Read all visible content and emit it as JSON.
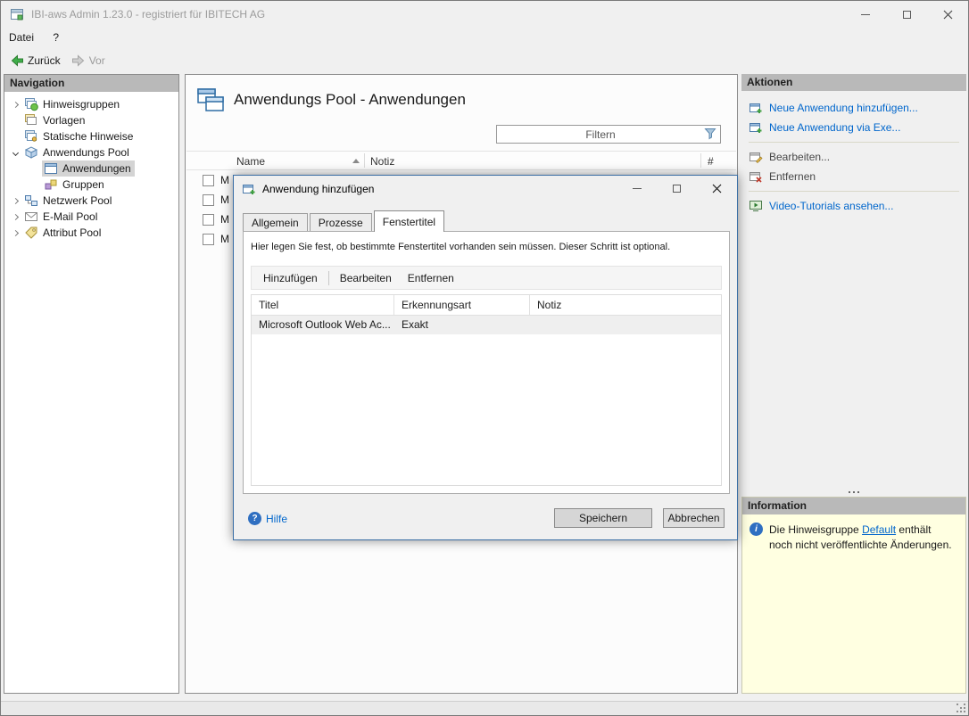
{
  "window": {
    "title": "IBI-aws Admin 1.23.0 - registriert für IBITECH AG"
  },
  "menubar": {
    "items": [
      {
        "label": "Datei"
      },
      {
        "label": "?"
      }
    ]
  },
  "navbar": {
    "back": "Zurück",
    "forward": "Vor"
  },
  "navigation": {
    "header": "Navigation",
    "items": [
      {
        "label": "Hinweisgruppen"
      },
      {
        "label": "Vorlagen"
      },
      {
        "label": "Statische Hinweise"
      },
      {
        "label": "Anwendungs Pool"
      },
      {
        "label": "Anwendungen"
      },
      {
        "label": "Gruppen"
      },
      {
        "label": "Netzwerk Pool"
      },
      {
        "label": "E-Mail Pool"
      },
      {
        "label": "Attribut Pool"
      }
    ]
  },
  "content": {
    "title": "Anwendungs Pool - Anwendungen",
    "filter_placeholder": "Filtern",
    "columns": {
      "name": "Name",
      "notiz": "Notiz",
      "hash": "#"
    },
    "rows": [
      {
        "name": "M"
      },
      {
        "name": "M"
      },
      {
        "name": "M"
      },
      {
        "name": "M"
      }
    ]
  },
  "dialog": {
    "title": "Anwendung hinzufügen",
    "tabs": [
      {
        "label": "Allgemein"
      },
      {
        "label": "Prozesse"
      },
      {
        "label": "Fenstertitel"
      }
    ],
    "active_tab": "Fenstertitel",
    "description": "Hier legen Sie fest, ob bestimmte Fenstertitel vorhanden sein müssen. Dieser Schritt ist optional.",
    "toolbar": {
      "add": "Hinzufügen",
      "edit": "Bearbeiten",
      "remove": "Entfernen"
    },
    "table": {
      "columns": {
        "titel": "Titel",
        "erkennungsart": "Erkennungsart",
        "notiz": "Notiz"
      },
      "rows": [
        {
          "titel": "Microsoft Outlook Web Ac...",
          "erkennungsart": "Exakt",
          "notiz": ""
        }
      ]
    },
    "help": "Hilfe",
    "save": "Speichern",
    "cancel": "Abbrechen"
  },
  "actions": {
    "header": "Aktionen",
    "items": [
      {
        "label": "Neue Anwendung hinzufügen...",
        "disabled": false
      },
      {
        "label": "Neue Anwendung via Exe...",
        "disabled": false
      },
      {
        "label": "Bearbeiten...",
        "disabled": true
      },
      {
        "label": "Entfernen",
        "disabled": true
      },
      {
        "label": "Video-Tutorials ansehen...",
        "disabled": false
      }
    ]
  },
  "information": {
    "header": "Information",
    "text_before": "Die Hinweisgruppe ",
    "link": "Default",
    "text_after": " enthält noch nicht veröffentlichte Änderungen."
  },
  "icons": {
    "info_glyph": "i",
    "help_glyph": "?"
  },
  "colors": {
    "link": "#0066cc",
    "info_bg": "#ffffe1",
    "panel_header_bg": "#b9b9b9",
    "dialog_border": "#3a6ea5",
    "back_arrow": "#3fae49"
  }
}
